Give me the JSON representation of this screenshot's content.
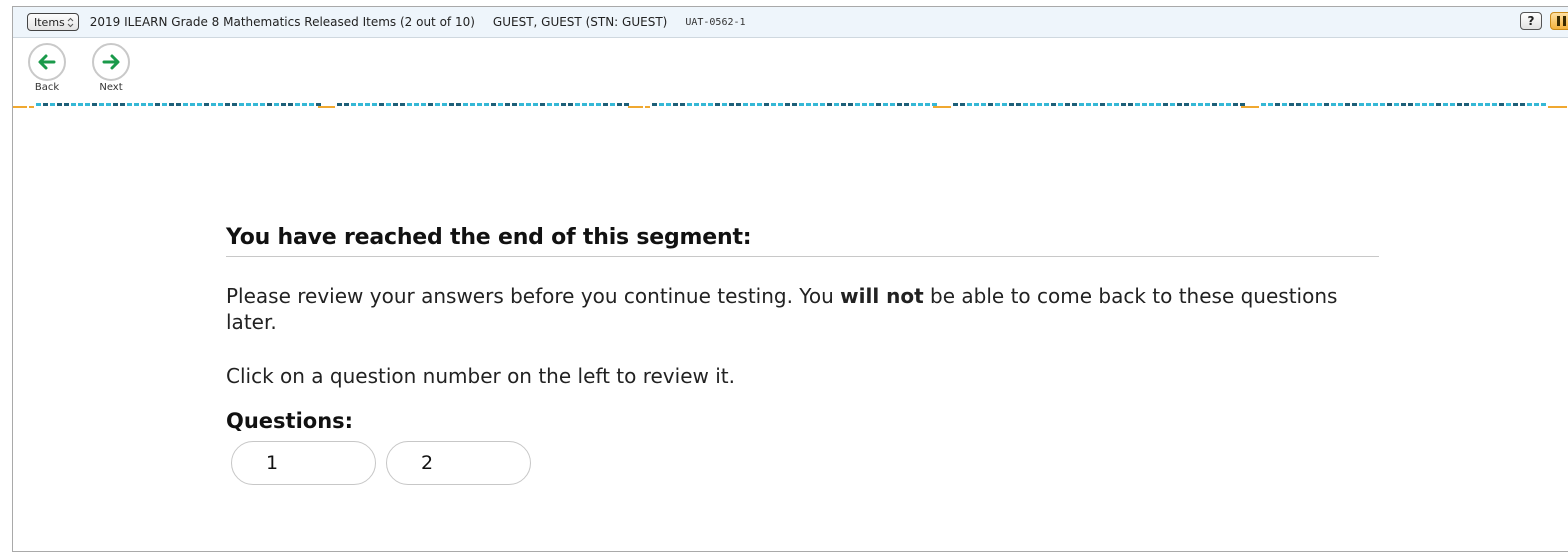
{
  "topbar": {
    "items_button_label": "Items",
    "test_title": "2019 ILEARN Grade 8 Mathematics Released Items (2 out of 10)",
    "student": "GUEST, GUEST (STN: GUEST)",
    "session_id": "UAT-0562-1",
    "help_label": "?"
  },
  "nav": {
    "back_label": "Back",
    "next_label": "Next",
    "arrow_color": "#1a9a4a"
  },
  "progress_colors": {
    "accent": "#f0a830",
    "light": "#35b8d6",
    "dark": "#1d5f78"
  },
  "main": {
    "heading": "You have reached the end of this segment:",
    "review_before": "Please review your answers before you continue testing. You ",
    "review_bold": "will not",
    "review_after": " be able to come back to these questions later.",
    "click_instruction": "Click on a question number on the left to review it.",
    "questions_label": "Questions:",
    "questions": [
      "1",
      "2"
    ]
  }
}
